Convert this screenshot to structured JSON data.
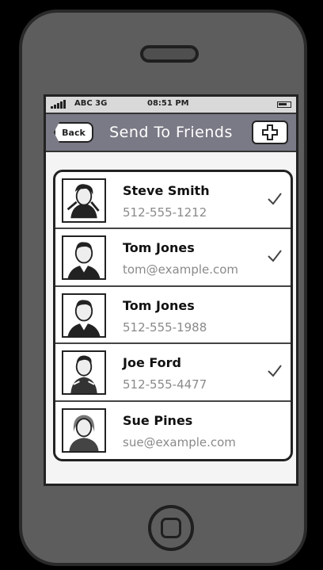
{
  "status": {
    "carrier": "ABC 3G",
    "time": "08:51 PM"
  },
  "nav": {
    "back_label": "Back",
    "title": "Send To Friends",
    "add_icon": "plus-icon"
  },
  "contacts": [
    {
      "name": "Steve Smith",
      "detail": "512-555-1212",
      "checked": true
    },
    {
      "name": "Tom Jones",
      "detail": "tom@example.com",
      "checked": true
    },
    {
      "name": "Tom Jones",
      "detail": "512-555-1988",
      "checked": false
    },
    {
      "name": "Joe Ford",
      "detail": "512-555-4477",
      "checked": true
    },
    {
      "name": "Sue Pines",
      "detail": "sue@example.com",
      "checked": false
    }
  ],
  "colors": {
    "navbar": "#7a7a86",
    "phone_body": "#5d5d5d",
    "detail_text": "#8a8a8a"
  }
}
